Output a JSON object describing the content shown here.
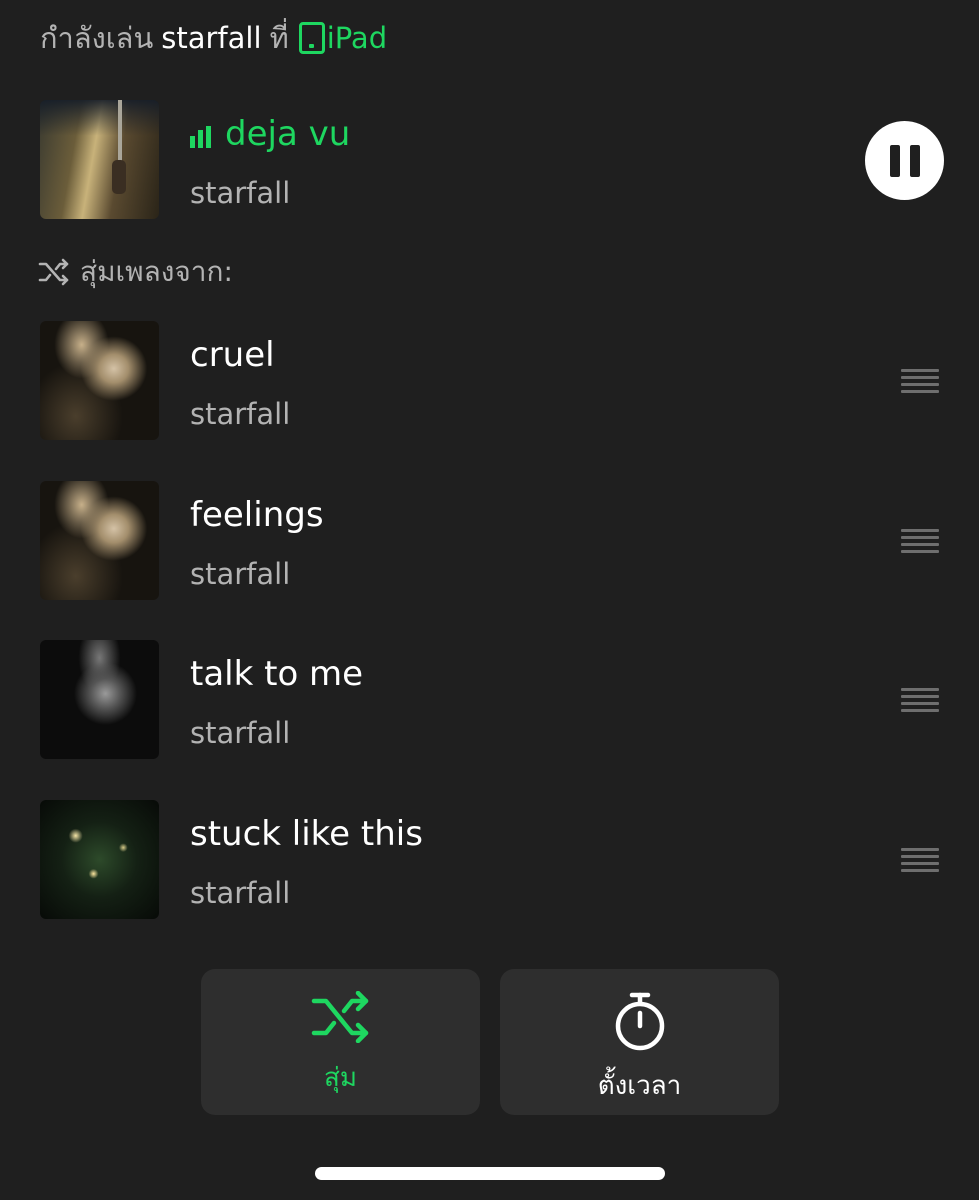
{
  "header": {
    "playing_prefix": "กำลังเล่น",
    "artist": "starfall",
    "connector": "ที่",
    "device": "iPad",
    "device_icon": "ipad-icon"
  },
  "now_playing": {
    "title": "deja vu",
    "artist": "starfall",
    "icon": "equalizer-icon",
    "control": "pause-icon"
  },
  "queue": {
    "label": "สุ่มเพลงจาก:",
    "icon": "shuffle-icon",
    "items": [
      {
        "title": "cruel",
        "artist": "starfall"
      },
      {
        "title": "feelings",
        "artist": "starfall"
      },
      {
        "title": "talk to me",
        "artist": "starfall"
      },
      {
        "title": "stuck like this",
        "artist": "starfall"
      }
    ]
  },
  "controls": {
    "shuffle_label": "สุ่ม",
    "shuffle_icon": "shuffle-icon",
    "timer_label": "ตั้งเวลา",
    "timer_icon": "timer-icon"
  },
  "colors": {
    "accent": "#1ed760",
    "background": "#1f1f1f",
    "button_background": "#2e2e2e",
    "secondary_text": "#b3b3b3"
  }
}
